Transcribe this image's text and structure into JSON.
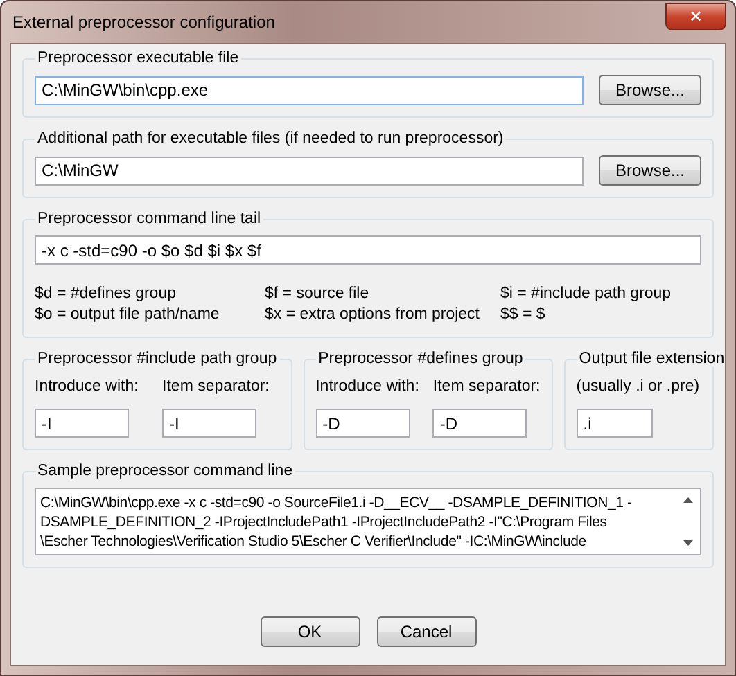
{
  "window": {
    "title": "External preprocessor configuration",
    "close": "✕"
  },
  "executable": {
    "title": "Preprocessor executable file",
    "value": "C:\\MinGW\\bin\\cpp.exe",
    "button": "Browse..."
  },
  "path": {
    "title": "Additional path for executable files (if needed to run preprocessor)",
    "value": "C:\\MinGW",
    "button": "Browse..."
  },
  "tail": {
    "title": "Preprocessor command line tail",
    "value": "-x c -std=c90 -o $o $d $i $x $f",
    "help": [
      "$d = #defines group",
      "$f = source file",
      "$i = #include path group",
      "$o = output file path/name",
      "$x = extra options from project",
      "$$ = $"
    ]
  },
  "include_group": {
    "title": "Preprocessor #include path group",
    "labels": [
      "Introduce with:",
      "Item separator:"
    ],
    "values": [
      "-I",
      "-I"
    ]
  },
  "defines_group": {
    "title": "Preprocessor #defines group",
    "labels": [
      "Introduce with:",
      "Item separator:"
    ],
    "values": [
      "-D",
      "-D"
    ]
  },
  "extension": {
    "title": "Output file extension",
    "hint": "(usually .i or .pre)",
    "value": ".i"
  },
  "sample": {
    "title": "Sample preprocessor command line",
    "lines": [
      "C:\\MinGW\\bin\\cpp.exe -x c -std=c90 -o SourceFile1.i -D__ECV__ -DSAMPLE_DEFINITION_1 -",
      "DSAMPLE_DEFINITION_2 -IProjectIncludePath1 -IProjectIncludePath2 -I\"C:\\Program Files",
      "\\Escher Technologies\\Verification Studio 5\\Escher C Verifier\\Include\" -IC:\\MinGW\\include"
    ]
  },
  "buttons": [
    "OK",
    "Cancel"
  ]
}
